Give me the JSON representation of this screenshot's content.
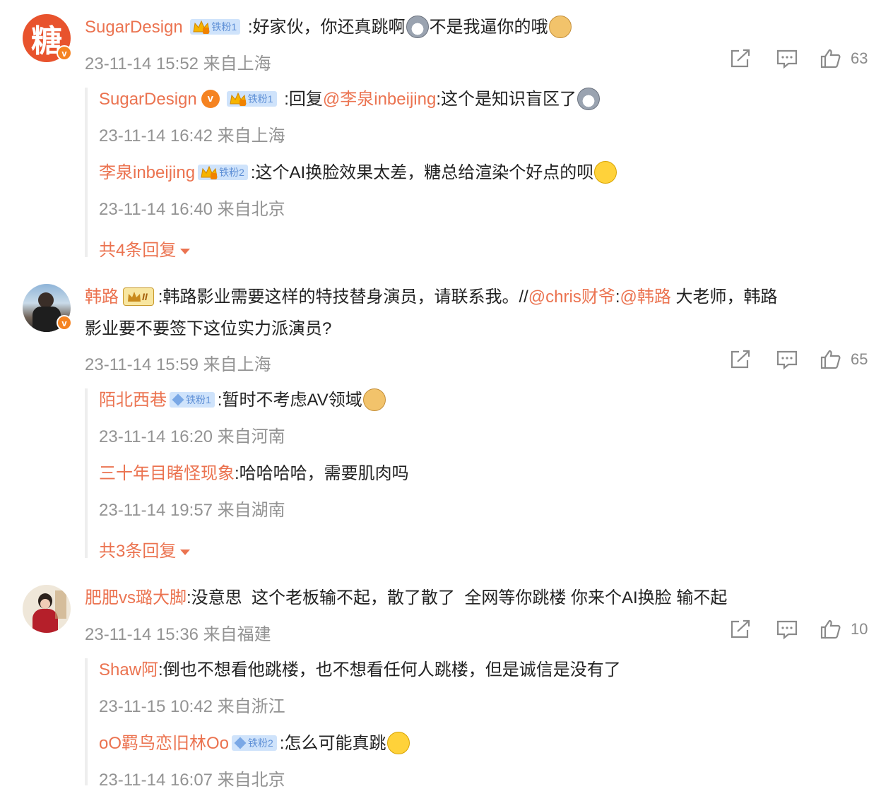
{
  "comments": [
    {
      "user": "SugarDesign",
      "fan_badge": "铁粉1",
      "text": ":好家伙，你还真跳啊",
      "text2": "不是我逼你的哦",
      "time": "23-11-14 15:52 来自上海",
      "likes": "63",
      "avatar_char": "糖",
      "replies": [
        {
          "user": "SugarDesign",
          "fan_badge": "铁粉1",
          "prefix": ":回复",
          "mention": "@李泉inbeijing",
          "text": ":这个是知识盲区了",
          "time": "23-11-14 16:42 来自上海"
        },
        {
          "user": "李泉inbeijing",
          "fan_badge": "铁粉2",
          "text": ":这个AI换脸效果太差，糖总给渲染个好点的呗",
          "time": "23-11-14 16:40 来自北京"
        }
      ],
      "more": "共4条回复"
    },
    {
      "user": "韩路",
      "rank_badge": "II",
      "text_line1": ":韩路影业需要这样的特技替身演员，请联系我。//",
      "mention1": "@chris财爷",
      "colon": ":",
      "mention2": "@韩路",
      "text_line1_end": " 大老师，韩路",
      "text_line2": "影业要不要签下这位实力派演员?",
      "time": "23-11-14 15:59 来自上海",
      "likes": "65",
      "replies": [
        {
          "user": "陌北西巷",
          "fan_badge": "铁粉1",
          "text": ":暂时不考虑AV领域",
          "time": "23-11-14 16:20 来自河南"
        },
        {
          "user": "三十年目睹怪现象",
          "text": ":哈哈哈哈，需要肌肉吗",
          "time": "23-11-14 19:57 来自湖南"
        }
      ],
      "more": "共3条回复"
    },
    {
      "user": "肥肥vs璐大脚",
      "text": ":没意思  这个老板输不起，散了散了  全网等你跳楼 你来个AI换脸 输不起",
      "time": "23-11-14 15:36 来自福建",
      "likes": "10",
      "replies": [
        {
          "user": "Shaw阿",
          "text": ":倒也不想看他跳楼，也不想看任何人跳楼，但是诚信是没有了",
          "time": "23-11-15 10:42 来自浙江"
        },
        {
          "user": "oO羁鸟恋旧林Oo",
          "fan_badge": "铁粉2",
          "text": ":怎么可能真跳",
          "time": "23-11-14 16:07 来自北京"
        }
      ]
    }
  ],
  "colors": {
    "name": "#eb7350",
    "time": "#939393",
    "text": "#222222",
    "avatar_brand": "#e8532d",
    "verified": "#f58321"
  },
  "icons": [
    "share-icon",
    "comment-icon",
    "like-icon",
    "verified-icon",
    "fan-badge-icon",
    "crown-icon",
    "chevron-down-icon"
  ]
}
